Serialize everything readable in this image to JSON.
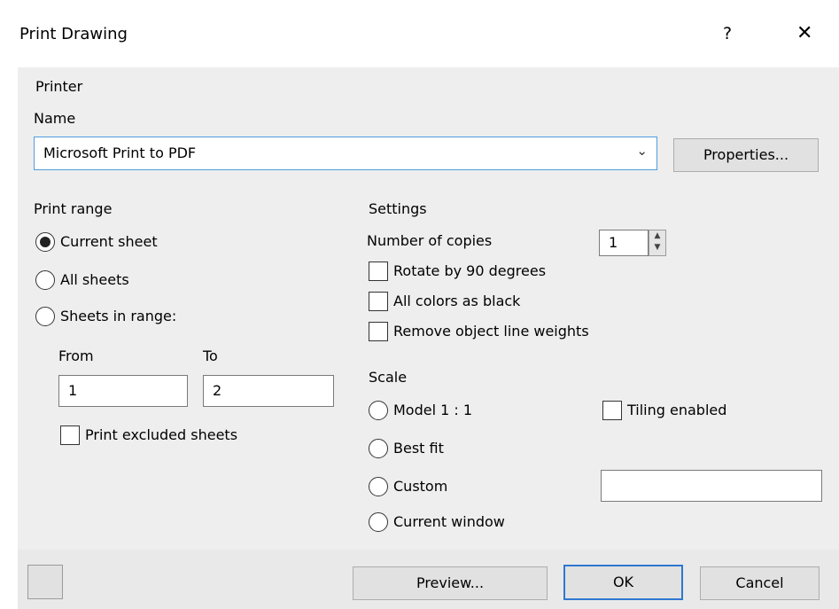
{
  "window": {
    "title": "Print Drawing",
    "help_label": "?",
    "close_label": "✕"
  },
  "printer": {
    "group_label": "Printer",
    "name_label": "Name",
    "selected": "Microsoft Print to PDF",
    "properties_label": "Properties..."
  },
  "print_range": {
    "group_label": "Print range",
    "options": [
      {
        "label": "Current sheet",
        "selected": true
      },
      {
        "label": "All sheets",
        "selected": false
      },
      {
        "label": "Sheets in range:",
        "selected": false
      }
    ],
    "from_label": "From",
    "to_label": "To",
    "from_value": "1",
    "to_value": "2",
    "excluded_label": "Print excluded sheets"
  },
  "settings": {
    "group_label": "Settings",
    "copies_label": "Number of copies",
    "copies_value": "1",
    "rotate_label": "Rotate by 90 degrees",
    "black_label": "All colors as black",
    "line_weights_label": "Remove object line weights"
  },
  "scale": {
    "group_label": "Scale",
    "options": [
      {
        "label": "Model 1 : 1"
      },
      {
        "label": "Best fit"
      },
      {
        "label": "Custom"
      },
      {
        "label": "Current window"
      }
    ],
    "tiling_label": "Tiling enabled",
    "custom_value": ""
  },
  "footer": {
    "preview_label": "Preview...",
    "ok_label": "OK",
    "cancel_label": "Cancel"
  }
}
